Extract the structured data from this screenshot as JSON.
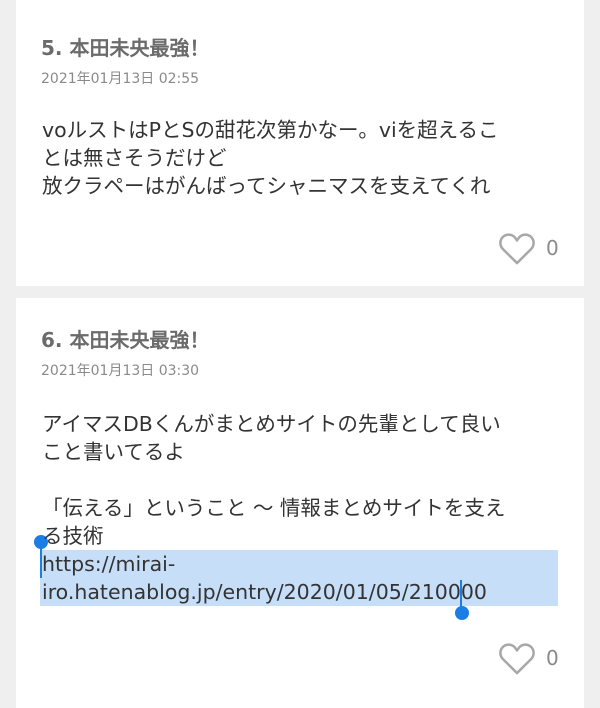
{
  "posts": [
    {
      "title": "5. 本田未央最強！",
      "date": "2021年01月13日 02:55",
      "lines": [
        "voルストはPとSの甜花次第かなー。viを超えるこ",
        "とは無さそうだけど",
        "放クラペーはがんばってシャニマスを支えてくれ"
      ],
      "likes": "0"
    },
    {
      "title": "6. 本田未央最強！",
      "date": "2021年01月13日 03:30",
      "lines": [
        "アイマスDBくんがまとめサイトの先輩として良い",
        "こと書いてるよ",
        "",
        "「伝える」ということ 〜 情報まとめサイトを支え",
        "る技術",
        "https://mirai-",
        "iro.hatenablog.jp/entry/2020/01/05/210000"
      ],
      "likes": "0"
    }
  ],
  "colors": {
    "background": "#efefef",
    "card": "#ffffff",
    "title": "#6b6b6b",
    "date": "#8a8a8a",
    "text": "#333333",
    "selection": "#c6def8",
    "selection_handle": "#1a7ee6"
  },
  "icons": {
    "like": "heart-outline-icon"
  }
}
